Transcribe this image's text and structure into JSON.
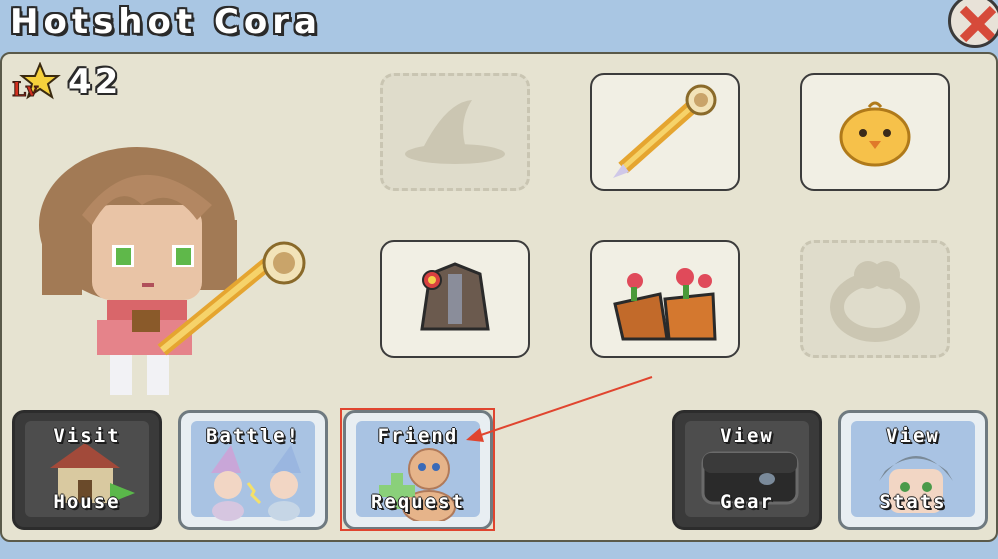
{
  "header": {
    "title": "Hotshot Cora",
    "close_icon": "close-x-icon"
  },
  "level": {
    "badge": "Lv",
    "value": "42"
  },
  "equipment": {
    "slots": [
      {
        "name": "hat",
        "icon": "wizard-hat-icon",
        "empty": true
      },
      {
        "name": "weapon",
        "icon": "telescope-staff-icon",
        "empty": false
      },
      {
        "name": "pet",
        "icon": "chick-pet-icon",
        "empty": false
      },
      {
        "name": "outfit",
        "icon": "coat-outfit-icon",
        "empty": false
      },
      {
        "name": "boots",
        "icon": "flower-boots-icon",
        "empty": false
      },
      {
        "name": "ring",
        "icon": "ring-icon",
        "empty": true
      }
    ]
  },
  "actions": {
    "visit": {
      "top": "Visit",
      "bottom": "House"
    },
    "battle": {
      "top": "Battle!"
    },
    "friend": {
      "top": "Friend",
      "bottom": "Request"
    },
    "gear": {
      "top": "View",
      "bottom": "Gear"
    },
    "stats": {
      "top": "View",
      "bottom": "Stats"
    }
  },
  "colors": {
    "panel": "#e6e3d1",
    "background": "#a9c6e3",
    "annotation": "#e0452f"
  }
}
